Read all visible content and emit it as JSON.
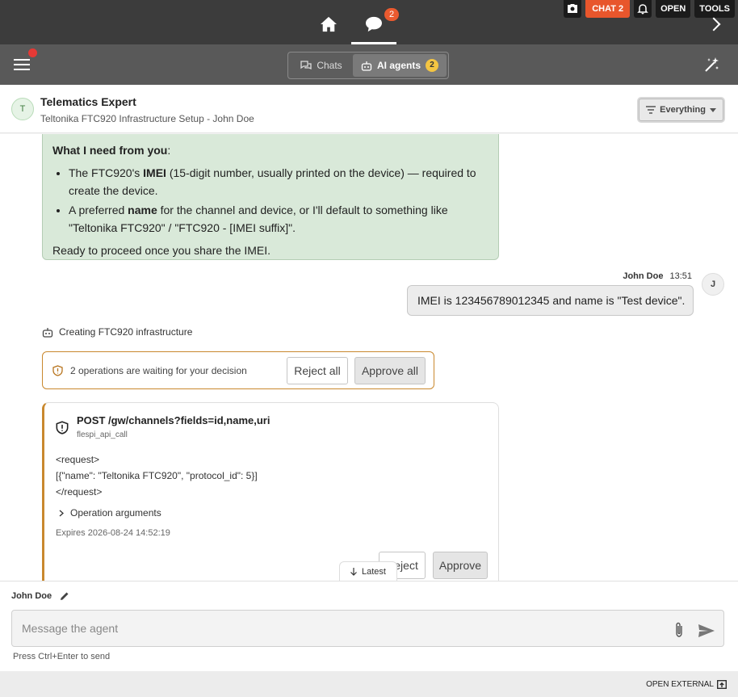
{
  "topbar": {
    "chat_badge": "2",
    "chat2_label": "CHAT 2",
    "open_label": "OPEN",
    "tools_label": "TOOLS"
  },
  "subbar": {
    "chats_label": "Chats",
    "agents_label": "AI agents",
    "agents_badge": "2"
  },
  "header": {
    "avatar_letter": "T",
    "agent_name": "Telematics Expert",
    "subtitle": "Teltonika FTC920 Infrastructure Setup - John Doe",
    "filter_label": "Everything"
  },
  "ai_message": {
    "heading": "What I need from you",
    "bullet1_pre": "The FTC920's ",
    "bullet1_bold": "IMEI",
    "bullet1_post": " (15-digit number, usually printed on the device) — required to create the device.",
    "bullet2_pre": "A preferred ",
    "bullet2_bold": "name",
    "bullet2_post": " for the channel and device, or I'll default to something like \"Teltonika FTC920\" / \"FTC920 - [IMEI suffix]\".",
    "closing": "Ready to proceed once you share the IMEI."
  },
  "user_message": {
    "author": "John Doe",
    "time": "13:51",
    "avatar_letter": "J",
    "text": "IMEI is 123456789012345 and name is \"Test device\"."
  },
  "task": {
    "label": "Creating FTC920 infrastructure"
  },
  "pending": {
    "text": "2 operations are waiting for your decision",
    "reject_all": "Reject all",
    "approve_all": "Approve all"
  },
  "operation": {
    "title": "POST /gw/channels?fields=id,name,uri",
    "tool": "flespi_api_call",
    "line1": "<request>",
    "line2": "[{\"name\": \"Teltonika FTC920\", \"protocol_id\": 5}]",
    "line3": "</request>",
    "args_label": "Operation arguments",
    "expires": "Expires 2026-08-24 14:52:19",
    "reject": "Reject",
    "approve": "Approve"
  },
  "latest_label": "Latest",
  "composer": {
    "user": "John Doe",
    "placeholder": "Message the agent",
    "hint": "Press Ctrl+Enter to send"
  },
  "footer": {
    "open_external": "OPEN EXTERNAL"
  }
}
